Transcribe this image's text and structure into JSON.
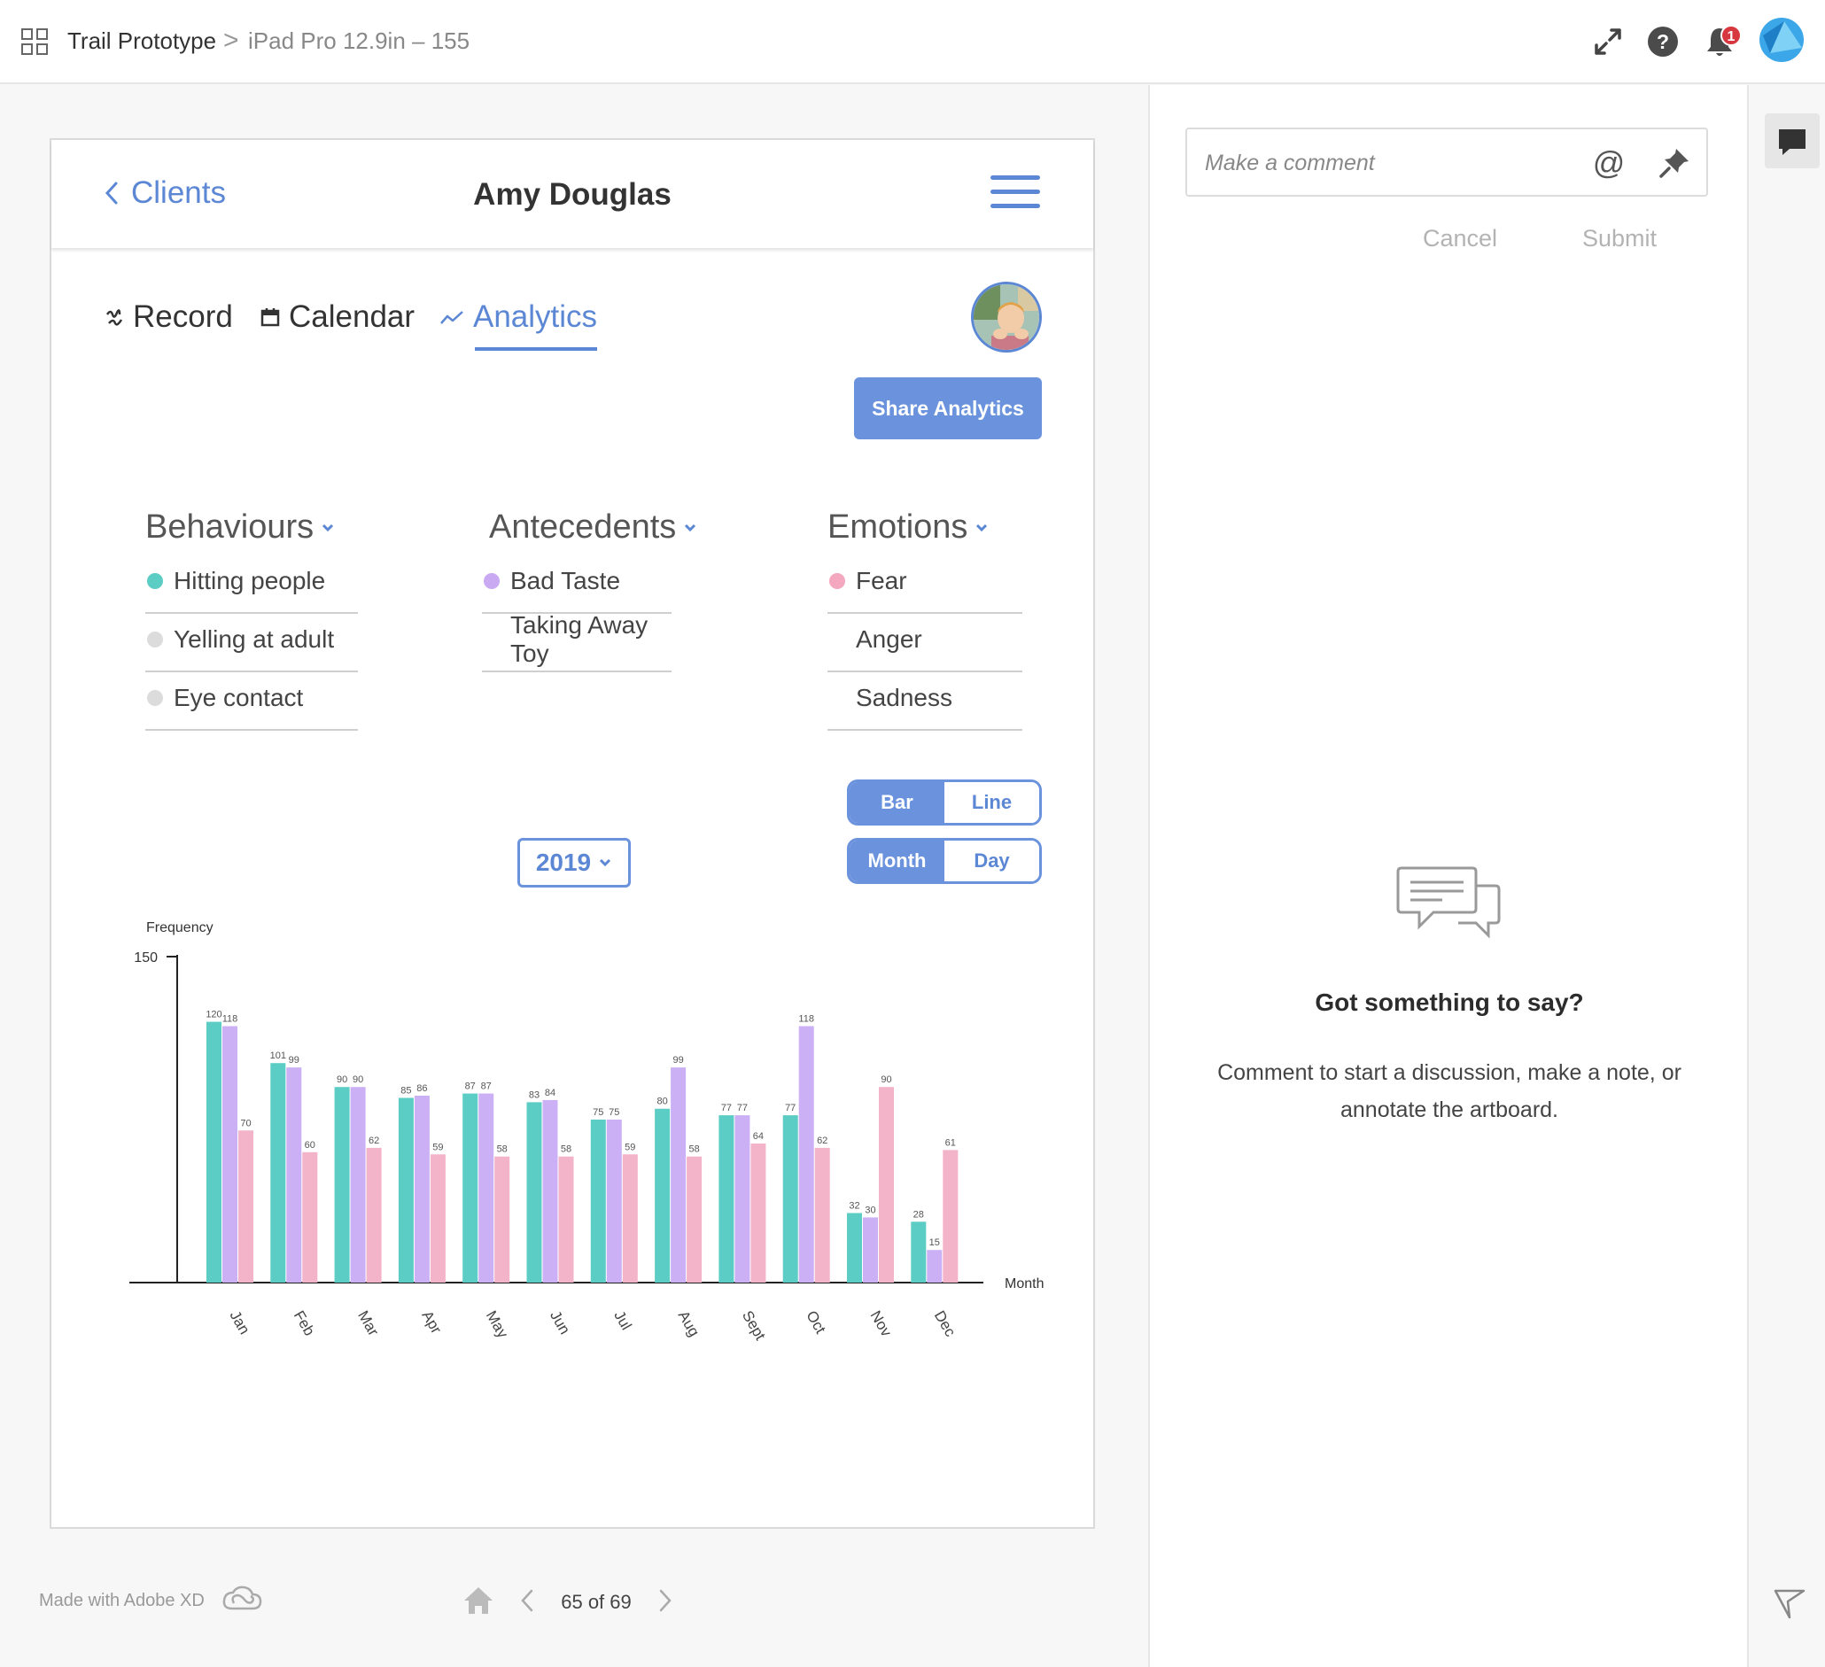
{
  "topbar": {
    "project": "Trail Prototype",
    "separator": ">",
    "page": "iPad Pro 12.9in – 155",
    "notification_count": "1"
  },
  "artboard": {
    "back_label": "Clients",
    "title": "Amy Douglas",
    "tabs": [
      {
        "label": "Record",
        "icon": "record-icon"
      },
      {
        "label": "Calendar",
        "icon": "calendar-icon"
      },
      {
        "label": "Analytics",
        "icon": "analytics-icon",
        "active": true
      }
    ],
    "share_button": "Share Analytics",
    "filters": {
      "behaviours": {
        "title": "Behaviours",
        "items": [
          {
            "label": "Hitting people",
            "color": "#5bcdc4"
          },
          {
            "label": "Yelling at adult",
            "color": "#dcdcdc"
          },
          {
            "label": "Eye contact",
            "color": "#dcdcdc"
          }
        ]
      },
      "antecedents": {
        "title": "Antecedents",
        "items": [
          {
            "label": "Bad Taste",
            "color": "#c9a9f2"
          },
          {
            "label": "Taking Away Toy",
            "color": null
          }
        ]
      },
      "emotions": {
        "title": "Emotions",
        "items": [
          {
            "label": "Fear",
            "color": "#f3a8c0"
          },
          {
            "label": "Anger",
            "color": null
          },
          {
            "label": "Sadness",
            "color": null
          }
        ]
      }
    },
    "chart_toggle": {
      "bar": "Bar",
      "line": "Line",
      "selected": "Bar"
    },
    "period_toggle": {
      "month": "Month",
      "day": "Day",
      "selected": "Month"
    },
    "year": "2019"
  },
  "chart_data": {
    "type": "bar",
    "ylabel": "Frequency",
    "xlabel": "Month",
    "yticks": [
      150
    ],
    "ylim": [
      0,
      150
    ],
    "grid": false,
    "legend": "none",
    "categories": [
      "Jan",
      "Feb",
      "Mar",
      "Apr",
      "May",
      "Jun",
      "Jul",
      "Aug",
      "Sept",
      "Oct",
      "Nov",
      "Dec"
    ],
    "series": [
      {
        "color": "#5bcdc4",
        "values": [
          120,
          101,
          90,
          85,
          87,
          83,
          75,
          80,
          77,
          77,
          32,
          28
        ]
      },
      {
        "color": "#cbb0f5",
        "values": [
          118,
          99,
          90,
          86,
          87,
          84,
          75,
          99,
          77,
          118,
          30,
          15
        ]
      },
      {
        "color": "#f3b3c8",
        "values": [
          70,
          60,
          62,
          59,
          58,
          58,
          59,
          58,
          64,
          62,
          90,
          61
        ]
      }
    ]
  },
  "footer": {
    "made_with": "Made with Adobe XD",
    "page_count": "65 of 69"
  },
  "comments": {
    "placeholder": "Make a comment",
    "cancel": "Cancel",
    "submit": "Submit",
    "empty_title": "Got something to say?",
    "empty_text": "Comment to start a discussion, make a note, or annotate the artboard."
  }
}
